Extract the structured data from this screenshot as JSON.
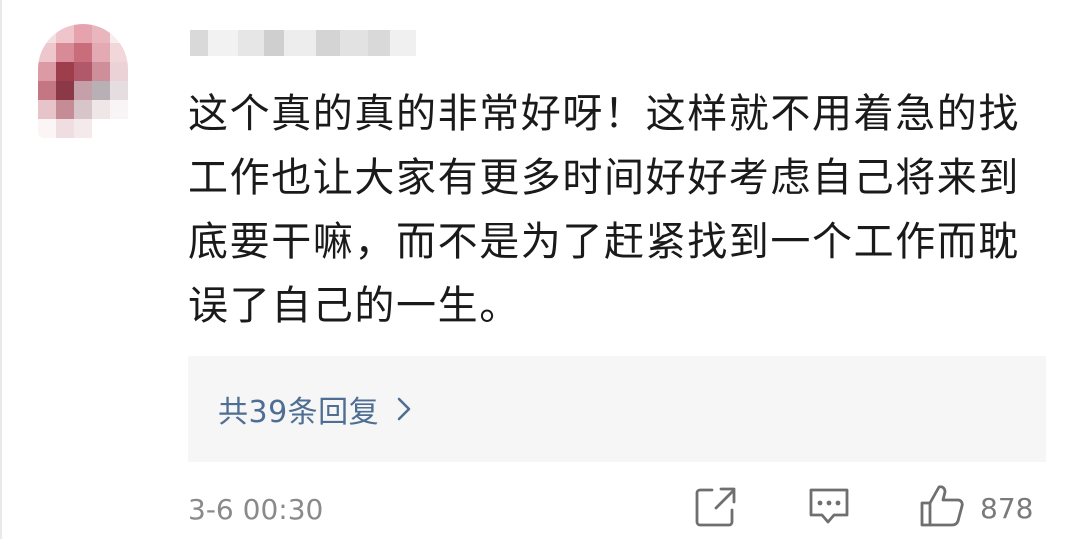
{
  "comment": {
    "text": "这个真的真的非常好呀！这样就不用着急的找工作也让大家有更多时间好好考虑自己将来到底要干嘛，而不是为了赶紧找到一个工作而耽误了自己的一生。",
    "replies_label": "共39条回复",
    "timestamp": "3-6 00:30",
    "like_count": "878"
  },
  "icons": {
    "avatar": "avatar-pixelated",
    "chevron": "chevron-right-icon",
    "share": "share-edit-icon",
    "comment": "comment-bubble-icon",
    "like": "thumbs-up-icon"
  },
  "colors": {
    "text": "#1a1a1a",
    "link": "#4e6e93",
    "muted": "#8a8a8a",
    "icon": "#6f6f6f",
    "reply_bg": "#f6f6f6"
  }
}
